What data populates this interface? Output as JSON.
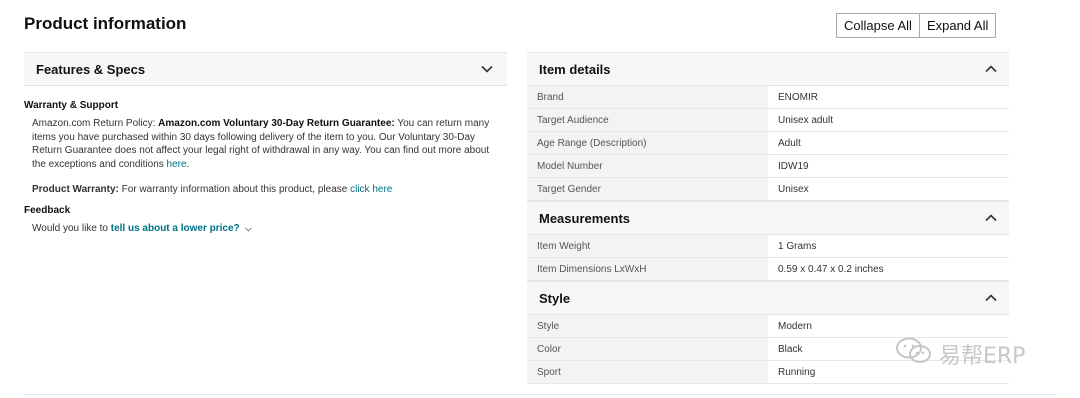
{
  "page": {
    "title": "Product information"
  },
  "actions": {
    "collapse_all": "Collapse All",
    "expand_all": "Expand All"
  },
  "features": {
    "header": "Features & Specs",
    "warranty_support_title": "Warranty & Support",
    "return_policy_prefix": "Amazon.com Return Policy: ",
    "return_policy_bold": "Amazon.com Voluntary 30-Day Return Guarantee:",
    "return_policy_text": " You can return many items you have purchased within 30 days following delivery of the item to you. Our Voluntary 30-Day Return Guarantee does not affect your legal right of withdrawal in any way. You can find out more about the exceptions and conditions ",
    "return_policy_link": "here",
    "return_policy_end": ".",
    "warranty_label": "Product Warranty:",
    "warranty_text": " For warranty information about this product, please ",
    "warranty_link": "click here",
    "feedback_title": "Feedback",
    "feedback_question": "Would you like to ",
    "feedback_link": "tell us about a lower price?"
  },
  "item_details": {
    "header": "Item details",
    "rows": [
      {
        "label": "Brand",
        "value": "ENOMIR"
      },
      {
        "label": "Target Audience",
        "value": "Unisex adult"
      },
      {
        "label": "Age Range (Description)",
        "value": "Adult"
      },
      {
        "label": "Model Number",
        "value": "IDW19"
      },
      {
        "label": "Target Gender",
        "value": "Unisex"
      }
    ]
  },
  "measurements": {
    "header": "Measurements",
    "rows": [
      {
        "label": "Item Weight",
        "value": "1 Grams"
      },
      {
        "label": "Item Dimensions LxWxH",
        "value": "0.59 x 0.47 x 0.2 inches"
      }
    ]
  },
  "style": {
    "header": "Style",
    "rows": [
      {
        "label": "Style",
        "value": "Modern"
      },
      {
        "label": "Color",
        "value": "Black"
      },
      {
        "label": "Sport",
        "value": "Running"
      }
    ]
  },
  "watermark": {
    "text": "易帮ERP"
  }
}
